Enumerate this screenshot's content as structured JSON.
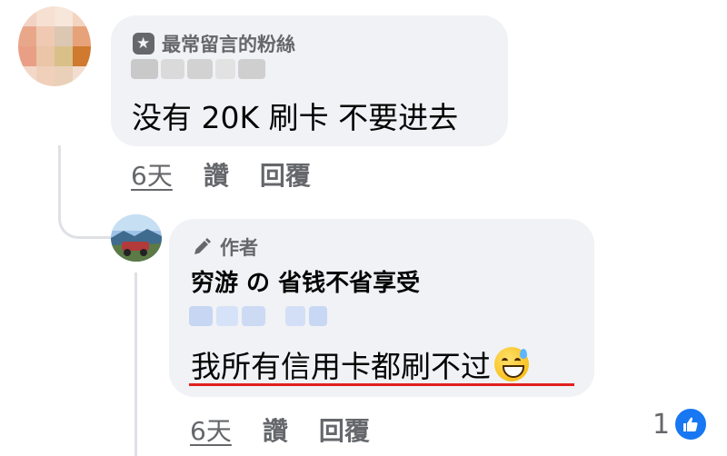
{
  "comment1": {
    "badge_label": "最常留言的粉絲",
    "text": "没有 20K 刷卡 不要进去",
    "time": "6天",
    "like_label": "讚",
    "reply_label": "回覆"
  },
  "comment2": {
    "badge_label": "作者",
    "author_name": "穷游 の 省钱不省享受",
    "text": "我所有信用卡都刷不过",
    "time": "6天",
    "like_label": "讚",
    "reply_label": "回覆",
    "reaction_count": "1"
  },
  "icons": {
    "fan_badge": "star-speech-bubble-icon",
    "author_badge": "pencil-icon",
    "reaction": "thumbs-up-icon",
    "emoji": "grinning-sweat-emoji"
  },
  "colors": {
    "bubble_bg": "#f0f2f5",
    "secondary_text": "#65676b",
    "highlight_underline": "#e02020",
    "like_blue": "#1877f2"
  }
}
